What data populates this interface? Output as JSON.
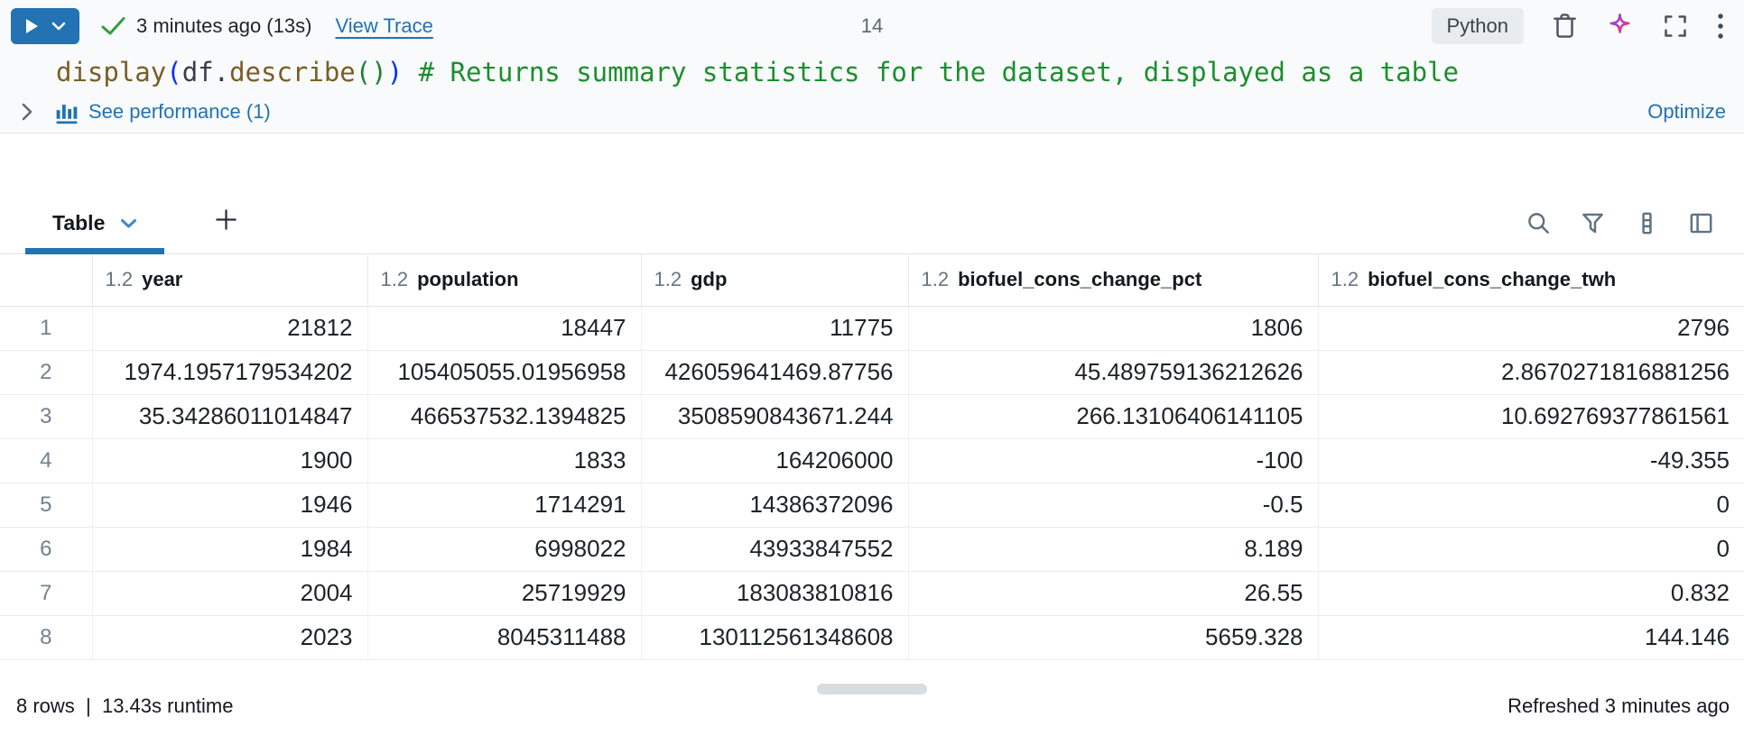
{
  "toolbar": {
    "run_status": "3 minutes ago (13s)",
    "view_trace": "View Trace",
    "cell_number": "14",
    "language": "Python"
  },
  "code": {
    "tokens": [
      {
        "type": "func",
        "text": "display"
      },
      {
        "type": "paren-blue",
        "text": "("
      },
      {
        "type": "plain",
        "text": "df"
      },
      {
        "type": "plain",
        "text": "."
      },
      {
        "type": "func",
        "text": "describe"
      },
      {
        "type": "paren-green",
        "text": "("
      },
      {
        "type": "paren-green",
        "text": ")"
      },
      {
        "type": "paren-blue",
        "text": ")"
      },
      {
        "type": "comment",
        "text": " # Returns summary statistics for the dataset, displayed as a table"
      }
    ]
  },
  "performance": {
    "label": "See performance (1)",
    "optimize": "Optimize"
  },
  "results": {
    "tab": "Table",
    "columns": [
      {
        "type": "1.2",
        "name": "year"
      },
      {
        "type": "1.2",
        "name": "population"
      },
      {
        "type": "1.2",
        "name": "gdp"
      },
      {
        "type": "1.2",
        "name": "biofuel_cons_change_pct"
      },
      {
        "type": "1.2",
        "name": "biofuel_cons_change_twh"
      }
    ],
    "rows": [
      {
        "n": "1",
        "values": [
          "21812",
          "18447",
          "11775",
          "1806",
          "2796"
        ]
      },
      {
        "n": "2",
        "values": [
          "1974.1957179534202",
          "105405055.01956958",
          "426059641469.87756",
          "45.489759136212626",
          "2.8670271816881256"
        ]
      },
      {
        "n": "3",
        "values": [
          "35.34286011014847",
          "466537532.1394825",
          "3508590843671.244",
          "266.13106406141105",
          "10.692769377861561"
        ]
      },
      {
        "n": "4",
        "values": [
          "1900",
          "1833",
          "164206000",
          "-100",
          "-49.355"
        ]
      },
      {
        "n": "5",
        "values": [
          "1946",
          "1714291",
          "14386372096",
          "-0.5",
          "0"
        ]
      },
      {
        "n": "6",
        "values": [
          "1984",
          "6998022",
          "43933847552",
          "8.189",
          "0"
        ]
      },
      {
        "n": "7",
        "values": [
          "2004",
          "25719929",
          "183083810816",
          "26.55",
          "0.832"
        ]
      },
      {
        "n": "8",
        "values": [
          "2023",
          "8045311488",
          "130112561348608",
          "5659.328",
          "144.146"
        ]
      }
    ],
    "footer_left": "8 rows  |  13.43s runtime",
    "footer_right": "Refreshed 3 minutes ago"
  },
  "colors": {
    "accent_blue": "#2272b4",
    "success_green": "#2f9e44",
    "comment_green": "#1a8f2e",
    "function_brown": "#795e26",
    "bracket_blue": "#0431fa",
    "bracket_green": "#1e7e34",
    "ai_gradient_start": "#7b52f4",
    "ai_gradient_end": "#ef3e5e"
  }
}
